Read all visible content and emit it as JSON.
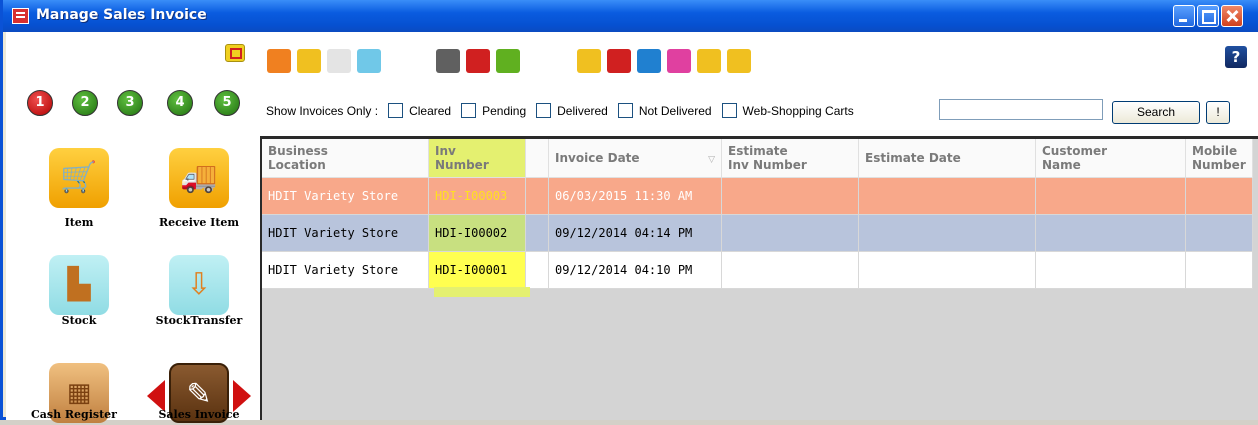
{
  "window": {
    "title": "Manage Sales Invoice"
  },
  "sidebar": {
    "steps": [
      "1",
      "2",
      "3",
      "4",
      "5"
    ],
    "tiles": [
      {
        "label": "Item",
        "icon": "shopping-cart-icon"
      },
      {
        "label": "Receive Item",
        "icon": "delivery-truck-icon"
      },
      {
        "label": "Stock",
        "icon": "hand-truck-icon"
      },
      {
        "label": "StockTransfer",
        "icon": "transfer-icon"
      },
      {
        "label": "Cash Register",
        "icon": "cash-register-icon"
      },
      {
        "label": "Sales Invoice",
        "icon": "invoice-edit-icon"
      }
    ]
  },
  "toolbar": {
    "icons": [
      "search-icon",
      "cancel-icon",
      "truck-disabled-icon",
      "truck-icon",
      "print-icon",
      "print-red-icon",
      "print-green-icon",
      "copy-icon",
      "minus-icon",
      "edit-icon",
      "help-doc-icon",
      "export-icon",
      "import-icon"
    ],
    "help_label": "?"
  },
  "filters": {
    "label": "Show Invoices Only :",
    "options": [
      "Cleared",
      "Pending",
      "Delivered",
      "Not Delivered",
      "Web-Shopping Carts"
    ],
    "search_value": "",
    "search_button": "Search",
    "bang_button": "!"
  },
  "grid": {
    "columns": [
      {
        "line1": "Business",
        "line2": "Location"
      },
      {
        "line1": "Inv",
        "line2": "Number"
      },
      {
        "line1": "",
        "line2": ""
      },
      {
        "line1": "Invoice Date",
        "line2": ""
      },
      {
        "line1": "Estimate",
        "line2": "Inv Number"
      },
      {
        "line1": "Estimate Date",
        "line2": ""
      },
      {
        "line1": "Customer",
        "line2": "Name"
      },
      {
        "line1": "Mobile",
        "line2": "Number"
      }
    ],
    "rows": [
      {
        "location": "HDIT Variety Store",
        "inv": "HDI-I00003",
        "date": "06/03/2015 11:30 AM"
      },
      {
        "location": "HDIT Variety Store",
        "inv": "HDI-I00002",
        "date": "09/12/2014 04:14 PM"
      },
      {
        "location": "HDIT Variety Store",
        "inv": "HDI-I00001",
        "date": "09/12/2014 04:10 PM"
      }
    ],
    "sort_indicator": "▽"
  },
  "colors": {
    "title_bar": "#0a5ce0",
    "selected_row": "#f8a88a",
    "alt_row": "#b8c4dc",
    "highlight_col": "#ffff50"
  }
}
